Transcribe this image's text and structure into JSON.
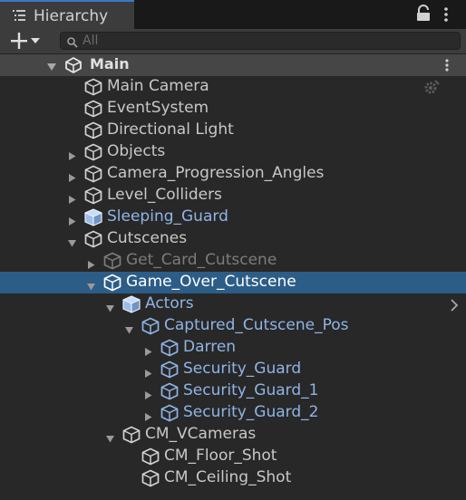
{
  "window": {
    "title": "Hierarchy",
    "tab_icon": "list-icon",
    "lock_icon": "lock-icon",
    "menu_icon": "kebab-menu-icon"
  },
  "toolbar": {
    "add_icon": "plus-dropdown-icon",
    "search_placeholder": "All",
    "search_icon": "search-icon"
  },
  "scene": {
    "name": "Main",
    "icon": "unity-logo-icon",
    "expanded": true,
    "menu_icon": "kebab-menu-icon"
  },
  "colors": {
    "selection": "#2c5d87",
    "prefab_text": "#8fb4e6",
    "normal_text": "#c8c8c8",
    "disabled_text": "#7c7c7c",
    "background": "#282828"
  },
  "hierarchy": [
    {
      "label": "Main Camera",
      "depth": 0,
      "arrow": "none",
      "type": "gameobject"
    },
    {
      "label": "EventSystem",
      "depth": 0,
      "arrow": "none",
      "type": "gameobject"
    },
    {
      "label": "Directional Light",
      "depth": 0,
      "arrow": "none",
      "type": "gameobject"
    },
    {
      "label": "Objects",
      "depth": 0,
      "arrow": "collapsed",
      "type": "gameobject"
    },
    {
      "label": "Camera_Progression_Angles",
      "depth": 0,
      "arrow": "collapsed",
      "type": "gameobject"
    },
    {
      "label": "Level_Colliders",
      "depth": 0,
      "arrow": "collapsed",
      "type": "gameobject"
    },
    {
      "label": "Sleeping_Guard",
      "depth": 0,
      "arrow": "collapsed",
      "type": "prefab-root"
    },
    {
      "label": "Cutscenes",
      "depth": 0,
      "arrow": "expanded",
      "type": "gameobject"
    },
    {
      "label": "Get_Card_Cutscene",
      "depth": 1,
      "arrow": "collapsed",
      "type": "disabled"
    },
    {
      "label": "Game_Over_Cutscene",
      "depth": 1,
      "arrow": "expanded",
      "type": "selected"
    },
    {
      "label": "Actors",
      "depth": 2,
      "arrow": "expanded",
      "type": "prefab-root"
    },
    {
      "label": "Captured_Cutscene_Pos",
      "depth": 3,
      "arrow": "expanded",
      "type": "prefab"
    },
    {
      "label": "Darren",
      "depth": 4,
      "arrow": "collapsed",
      "type": "prefab"
    },
    {
      "label": "Security_Guard",
      "depth": 4,
      "arrow": "collapsed",
      "type": "prefab"
    },
    {
      "label": "Security_Guard_1",
      "depth": 4,
      "arrow": "collapsed",
      "type": "prefab"
    },
    {
      "label": "Security_Guard_2",
      "depth": 4,
      "arrow": "collapsed",
      "type": "prefab"
    },
    {
      "label": "CM_VCameras",
      "depth": 2,
      "arrow": "expanded",
      "type": "gameobject"
    },
    {
      "label": "CM_Floor_Shot",
      "depth": 3,
      "arrow": "none",
      "type": "gameobject"
    },
    {
      "label": "CM_Ceiling_Shot",
      "depth": 3,
      "arrow": "none",
      "type": "gameobject"
    }
  ],
  "row_icons": {
    "main_camera_extra": "gear-icon",
    "actors_extra": "chevron-right-icon"
  }
}
